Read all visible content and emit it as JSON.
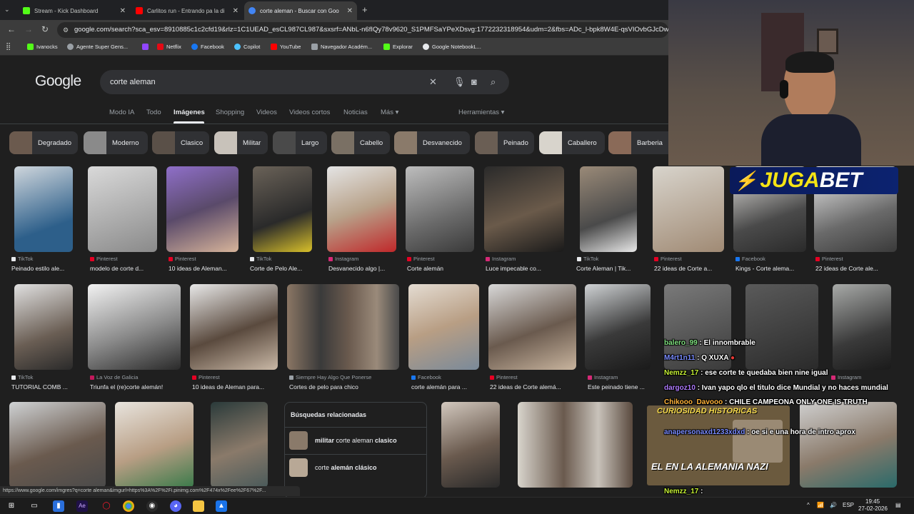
{
  "browser": {
    "tabs": [
      {
        "title": "Stream - Kick Dashboard",
        "color": "#53fc18"
      },
      {
        "title": "Carlitos run - Entrando pa la di",
        "color": "#ff0000"
      },
      {
        "title": "corte aleman - Buscar con Goo",
        "color": "#4285f4"
      }
    ],
    "new_tab": "+",
    "address": "google.com/search?sca_esv=8910885c1c2cfd19&rlz=1C1UEAD_esCL987CL987&sxsrf=ANbL-n6fIQy78v9620_S1PMFSaYPeXDsvg:1772232318954&udm=2&fbs=ADc_l-bpk8W4E-qsVIOvbGJcDwpn60DczFe",
    "bookmarks": [
      "Ivanocks",
      "Agente Super Gens...",
      "",
      "Netflix",
      "Facebook",
      "Copilot",
      "YouTube",
      "Navegador Académ...",
      "Explorar",
      "Google NotebookL..."
    ]
  },
  "google": {
    "logo": "Google",
    "query": "corte aleman",
    "nav_tabs": [
      "Modo IA",
      "Todo",
      "Imágenes",
      "Shopping",
      "Videos",
      "Videos cortos",
      "Noticias",
      "Más ▾"
    ],
    "tools": "Herramientas ▾",
    "chips": [
      "Degradado",
      "Moderno",
      "Clasico",
      "Militar",
      "Largo",
      "Cabello",
      "Desvanecido",
      "Peinado",
      "Caballero",
      "Barberia"
    ],
    "row1": [
      {
        "source": "TikTok",
        "title": "Peinado estilo ale..."
      },
      {
        "source": "Pinterest",
        "title": "modelo de corte d..."
      },
      {
        "source": "Pinterest",
        "title": "10 ideas de Aleman..."
      },
      {
        "source": "TikTok",
        "title": "Corte de Pelo Ale..."
      },
      {
        "source": "Instagram",
        "title": "Desvanecido algo |..."
      },
      {
        "source": "Pinterest",
        "title": "Corte alemán"
      },
      {
        "source": "Instagram",
        "title": "Luce impecable co..."
      },
      {
        "source": "TikTok",
        "title": "Corte Aleman | Tik..."
      },
      {
        "source": "Pinterest",
        "title": "22 ideas de Corte a..."
      },
      {
        "source": "Facebook",
        "title": "Kings - Corte alema..."
      },
      {
        "source": "Pinterest",
        "title": "22 ideas de Corte ale..."
      }
    ],
    "row2": [
      {
        "source": "TikTok",
        "title": "TUTORIAL COMB ..."
      },
      {
        "source": "La Voz de Galicia",
        "title": "Triunfa el (re)corte alemán!"
      },
      {
        "source": "Pinterest",
        "title": "10 ideas de Aleman para..."
      },
      {
        "source": "Siempre Hay Algo Que Ponerse",
        "title": "Cortes de pelo para chico"
      },
      {
        "source": "Facebook",
        "title": "corte alemán para ..."
      },
      {
        "source": "Pinterest",
        "title": "22 ideas de Corte alemá..."
      },
      {
        "source": "Instagram",
        "title": "Este peinado tiene ..."
      },
      {
        "source": "Instagram",
        "title": ""
      }
    ],
    "related": {
      "heading": "Búsquedas relacionadas",
      "items": [
        {
          "bold_a": "militar",
          "normal": " corte aleman ",
          "bold_b": "clasico"
        },
        {
          "bold_a": "",
          "normal": "corte ",
          "bold_b": "alemán clásico"
        }
      ]
    },
    "status_url": "https://www.google.com/imgres?q=corte aleman&imgurl=https%3A%2F%2Fi.pinimg.com%2F474x%2Fee%2F67%2F..."
  },
  "overlay": {
    "sponsor_a": "JUGA",
    "sponsor_b": "BET",
    "chat": [
      {
        "user": "balero_99",
        "msg": ": El innombrable",
        "color": "#7fe07f"
      },
      {
        "user": "M4rt1n11",
        "msg": ": Q XUXA",
        "color": "#7a8cff"
      },
      {
        "user": "Nemzz_17",
        "msg": ": ese corte te quedaba bien nine igual",
        "color": "#c6f135"
      },
      {
        "user": "dargoz10",
        "msg": ": Ivan yapo qlo el titulo dice Mundial y no haces mundial",
        "color": "#b07cff"
      },
      {
        "user": "Chikooo_Davooo",
        "msg": ": CHILE CAMPEONA ONLY ONE IS TRUTH",
        "color": "#ffb33a"
      },
      {
        "user": "anapersonaxd1233xdxd",
        "msg": ": oe si e una hora de intro aprox",
        "color": "#7a8cff"
      },
      {
        "user": "Nemzz_17",
        "msg": ":",
        "color": "#c6f135"
      }
    ],
    "curiosidad": "CURIOSIDAD HISTORICAS",
    "curiosidad_sub": "EL EN LA ALEMANIA NAZI"
  },
  "taskbar": {
    "time": "19:45",
    "date": "27-02-2026",
    "lang": "ESP"
  }
}
